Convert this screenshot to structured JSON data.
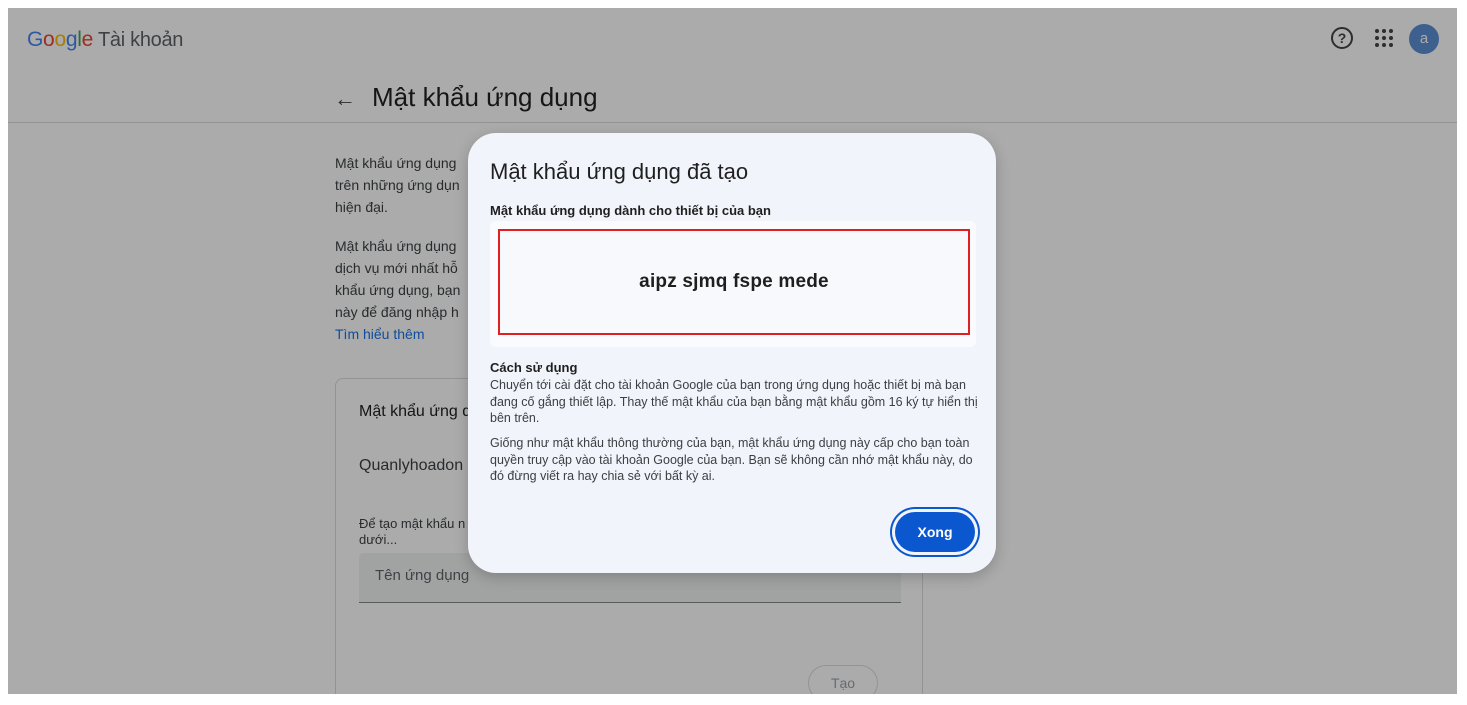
{
  "header": {
    "logo_letters": [
      "G",
      "o",
      "o",
      "g",
      "l",
      "e"
    ],
    "product": "Tài khoản",
    "help_icon": "help-circle-icon",
    "apps_icon": "apps-grid-icon",
    "avatar_letter": "a"
  },
  "subheader": {
    "back_icon": "arrow-back-icon",
    "back_glyph": "←",
    "title": "Mật khẩu ứng dụng"
  },
  "background": {
    "intro1": "Mật khẩu ứng dụng",
    "intro1b": "trên những ứng dụn",
    "intro1c": "hiện đại.",
    "intro2a": "Mật khẩu ứng dụng",
    "intro2b": "dịch vụ mới nhất hỗ",
    "intro2c": "khẩu ứng dụng, bạn",
    "intro2d": "này để đăng nhập h",
    "learn_more": "Tìm hiểu thêm",
    "card_title": "Mật khẩu ứng d",
    "app_item": "Quanlyhoadon",
    "create_hint_a": "Để tạo mật khẩu n",
    "create_hint_b": "dưới...",
    "app_name_placeholder": "Tên ứng dụng",
    "create_button": "Tạo"
  },
  "dialog": {
    "title": "Mật khẩu ứng dụng đã tạo",
    "subtitle": "Mật khẩu ứng dụng dành cho thiết bị của bạn",
    "password": "aipz sjmq fspe mede",
    "usage_title": "Cách sử dụng",
    "usage_p1": "Chuyển tới cài đặt cho tài khoản Google của bạn trong ứng dụng hoặc thiết bị mà bạn đang cố gắng thiết lập. Thay thế mật khẩu của bạn bằng mật khẩu gồm 16 ký tự hiển thị bên trên.",
    "usage_p2": "Giống như mật khẩu thông thường của bạn, mật khẩu ứng dụng này cấp cho bạn toàn quyền truy cập vào tài khoản Google của bạn. Bạn sẽ không cần nhớ mật khẩu này, do đó đừng viết ra hay chia sẻ với bất kỳ ai.",
    "done_button": "Xong",
    "highlight_color": "#e02020",
    "accent_color": "#0b57d0"
  }
}
